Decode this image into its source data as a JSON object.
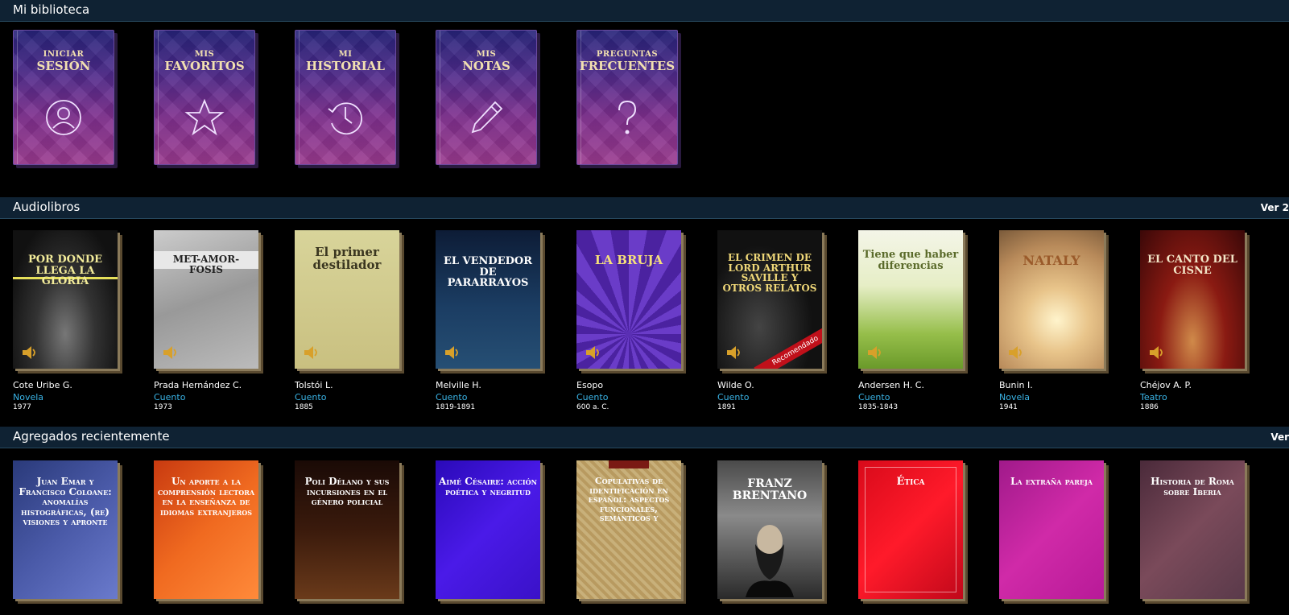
{
  "sections": {
    "biblioteca": {
      "title": "Mi biblioteca"
    },
    "audiolibros": {
      "title": "Audiolibros",
      "ver_label": "Ver 2"
    },
    "recientes": {
      "title": "Agregados recientemente",
      "ver_label": "Ver"
    }
  },
  "menu": [
    {
      "line1": "INICIAR",
      "line2": "SESIÓN",
      "icon": "user-icon"
    },
    {
      "line1": "MIS",
      "line2": "FAVORITOS",
      "icon": "star-icon"
    },
    {
      "line1": "MI",
      "line2": "HISTORIAL",
      "icon": "clock-icon"
    },
    {
      "line1": "MIS",
      "line2": "NOTAS",
      "icon": "pencil-icon"
    },
    {
      "line1": "PREGUNTAS",
      "line2": "FRECUENTES",
      "icon": "question-icon"
    }
  ],
  "audiobooks": [
    {
      "title": "Por donde llega la gloria",
      "author": "Cote Uribe G.",
      "genre": "Novela",
      "year": "1977"
    },
    {
      "title": "Met-amor-fosis",
      "author": "Prada Hernández C.",
      "genre": "Cuento",
      "year": "1973"
    },
    {
      "title": "El primer destilador",
      "author": "Tolstói L.",
      "genre": "Cuento",
      "year": "1885"
    },
    {
      "title": "El vendedor de pararrayos",
      "author": "Melville H.",
      "genre": "Cuento",
      "year": "1819-1891"
    },
    {
      "title": "La bruja",
      "author": "Esopo",
      "genre": "Cuento",
      "year": "600 a. C."
    },
    {
      "title": "El crimen de Lord Arthur Saville y otros relatos",
      "author": "Wilde O.",
      "genre": "Cuento",
      "year": "1891",
      "badge": "Recomendado"
    },
    {
      "title": "Tiene que haber diferencias",
      "author": "Andersen H. C.",
      "genre": "Cuento",
      "year": "1835-1843"
    },
    {
      "title": "Nataly",
      "author": "Bunin I.",
      "genre": "Novela",
      "year": "1941"
    },
    {
      "title": "El canto del cisne",
      "author": "Chéjov A. P.",
      "genre": "Teatro",
      "year": "1886"
    }
  ],
  "recent": [
    {
      "title": "Juan Emar y Francisco Coloane: anomalías histográficas, (re) visiones y apronte"
    },
    {
      "title": "Un aporte a la comprensión lectora en la enseñanza de idiomas extranjeros"
    },
    {
      "title": "Poli Délano y sus incursiones en el género policial"
    },
    {
      "title": "Aimé Césaire: acción poética y negritud"
    },
    {
      "title": "Copulativas de identificación en español: aspectos funcionales, semánticos y"
    },
    {
      "title": "Franz Brentano"
    },
    {
      "title": "Ética"
    },
    {
      "title": "La extraña pareja"
    },
    {
      "title": "Historia de Roma sobre Iberia"
    }
  ],
  "colors": {
    "accent": "#3ab4e6",
    "header_bg": "#0f2233"
  }
}
